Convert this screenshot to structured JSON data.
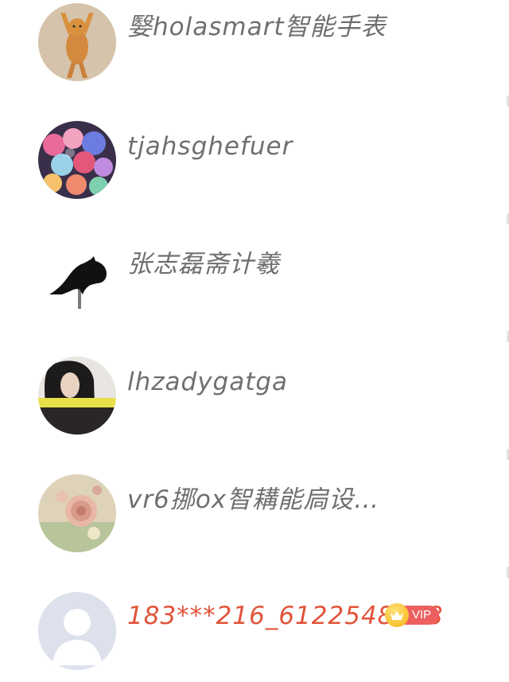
{
  "users": [
    {
      "name": "嫛holasmart智能手表",
      "vip": false,
      "avatar": "cat-photo"
    },
    {
      "name": "tjahsghefuer",
      "vip": false,
      "avatar": "balloons-photo"
    },
    {
      "name": "张志磊斋计羲",
      "vip": false,
      "avatar": "cat-silhouette"
    },
    {
      "name": "lhzadygatga",
      "vip": false,
      "avatar": "girl-photo"
    },
    {
      "name": "vr6挪ox智耩能扃设…",
      "vip": false,
      "avatar": "rose-photo"
    },
    {
      "name": "183***216_6122548198",
      "vip": true,
      "vip_label": "VIP",
      "avatar": "default-person"
    }
  ],
  "colors": {
    "name_text": "#6f6f6f",
    "vip_name_text": "#e2533a",
    "vip_badge": "#ec5f5f",
    "crown": "#f5b20f"
  }
}
